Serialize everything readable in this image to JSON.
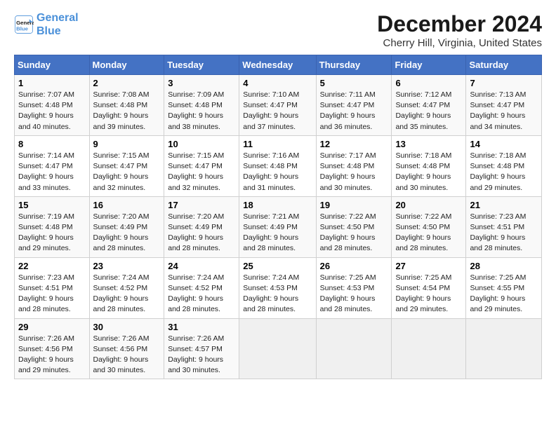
{
  "header": {
    "logo_line1": "General",
    "logo_line2": "Blue",
    "title": "December 2024",
    "location": "Cherry Hill, Virginia, United States"
  },
  "weekdays": [
    "Sunday",
    "Monday",
    "Tuesday",
    "Wednesday",
    "Thursday",
    "Friday",
    "Saturday"
  ],
  "weeks": [
    [
      {
        "day": "1",
        "sunrise": "Sunrise: 7:07 AM",
        "sunset": "Sunset: 4:48 PM",
        "daylight": "Daylight: 9 hours and 40 minutes."
      },
      {
        "day": "2",
        "sunrise": "Sunrise: 7:08 AM",
        "sunset": "Sunset: 4:48 PM",
        "daylight": "Daylight: 9 hours and 39 minutes."
      },
      {
        "day": "3",
        "sunrise": "Sunrise: 7:09 AM",
        "sunset": "Sunset: 4:48 PM",
        "daylight": "Daylight: 9 hours and 38 minutes."
      },
      {
        "day": "4",
        "sunrise": "Sunrise: 7:10 AM",
        "sunset": "Sunset: 4:47 PM",
        "daylight": "Daylight: 9 hours and 37 minutes."
      },
      {
        "day": "5",
        "sunrise": "Sunrise: 7:11 AM",
        "sunset": "Sunset: 4:47 PM",
        "daylight": "Daylight: 9 hours and 36 minutes."
      },
      {
        "day": "6",
        "sunrise": "Sunrise: 7:12 AM",
        "sunset": "Sunset: 4:47 PM",
        "daylight": "Daylight: 9 hours and 35 minutes."
      },
      {
        "day": "7",
        "sunrise": "Sunrise: 7:13 AM",
        "sunset": "Sunset: 4:47 PM",
        "daylight": "Daylight: 9 hours and 34 minutes."
      }
    ],
    [
      {
        "day": "8",
        "sunrise": "Sunrise: 7:14 AM",
        "sunset": "Sunset: 4:47 PM",
        "daylight": "Daylight: 9 hours and 33 minutes."
      },
      {
        "day": "9",
        "sunrise": "Sunrise: 7:15 AM",
        "sunset": "Sunset: 4:47 PM",
        "daylight": "Daylight: 9 hours and 32 minutes."
      },
      {
        "day": "10",
        "sunrise": "Sunrise: 7:15 AM",
        "sunset": "Sunset: 4:47 PM",
        "daylight": "Daylight: 9 hours and 32 minutes."
      },
      {
        "day": "11",
        "sunrise": "Sunrise: 7:16 AM",
        "sunset": "Sunset: 4:48 PM",
        "daylight": "Daylight: 9 hours and 31 minutes."
      },
      {
        "day": "12",
        "sunrise": "Sunrise: 7:17 AM",
        "sunset": "Sunset: 4:48 PM",
        "daylight": "Daylight: 9 hours and 30 minutes."
      },
      {
        "day": "13",
        "sunrise": "Sunrise: 7:18 AM",
        "sunset": "Sunset: 4:48 PM",
        "daylight": "Daylight: 9 hours and 30 minutes."
      },
      {
        "day": "14",
        "sunrise": "Sunrise: 7:18 AM",
        "sunset": "Sunset: 4:48 PM",
        "daylight": "Daylight: 9 hours and 29 minutes."
      }
    ],
    [
      {
        "day": "15",
        "sunrise": "Sunrise: 7:19 AM",
        "sunset": "Sunset: 4:48 PM",
        "daylight": "Daylight: 9 hours and 29 minutes."
      },
      {
        "day": "16",
        "sunrise": "Sunrise: 7:20 AM",
        "sunset": "Sunset: 4:49 PM",
        "daylight": "Daylight: 9 hours and 28 minutes."
      },
      {
        "day": "17",
        "sunrise": "Sunrise: 7:20 AM",
        "sunset": "Sunset: 4:49 PM",
        "daylight": "Daylight: 9 hours and 28 minutes."
      },
      {
        "day": "18",
        "sunrise": "Sunrise: 7:21 AM",
        "sunset": "Sunset: 4:49 PM",
        "daylight": "Daylight: 9 hours and 28 minutes."
      },
      {
        "day": "19",
        "sunrise": "Sunrise: 7:22 AM",
        "sunset": "Sunset: 4:50 PM",
        "daylight": "Daylight: 9 hours and 28 minutes."
      },
      {
        "day": "20",
        "sunrise": "Sunrise: 7:22 AM",
        "sunset": "Sunset: 4:50 PM",
        "daylight": "Daylight: 9 hours and 28 minutes."
      },
      {
        "day": "21",
        "sunrise": "Sunrise: 7:23 AM",
        "sunset": "Sunset: 4:51 PM",
        "daylight": "Daylight: 9 hours and 28 minutes."
      }
    ],
    [
      {
        "day": "22",
        "sunrise": "Sunrise: 7:23 AM",
        "sunset": "Sunset: 4:51 PM",
        "daylight": "Daylight: 9 hours and 28 minutes."
      },
      {
        "day": "23",
        "sunrise": "Sunrise: 7:24 AM",
        "sunset": "Sunset: 4:52 PM",
        "daylight": "Daylight: 9 hours and 28 minutes."
      },
      {
        "day": "24",
        "sunrise": "Sunrise: 7:24 AM",
        "sunset": "Sunset: 4:52 PM",
        "daylight": "Daylight: 9 hours and 28 minutes."
      },
      {
        "day": "25",
        "sunrise": "Sunrise: 7:24 AM",
        "sunset": "Sunset: 4:53 PM",
        "daylight": "Daylight: 9 hours and 28 minutes."
      },
      {
        "day": "26",
        "sunrise": "Sunrise: 7:25 AM",
        "sunset": "Sunset: 4:53 PM",
        "daylight": "Daylight: 9 hours and 28 minutes."
      },
      {
        "day": "27",
        "sunrise": "Sunrise: 7:25 AM",
        "sunset": "Sunset: 4:54 PM",
        "daylight": "Daylight: 9 hours and 29 minutes."
      },
      {
        "day": "28",
        "sunrise": "Sunrise: 7:25 AM",
        "sunset": "Sunset: 4:55 PM",
        "daylight": "Daylight: 9 hours and 29 minutes."
      }
    ],
    [
      {
        "day": "29",
        "sunrise": "Sunrise: 7:26 AM",
        "sunset": "Sunset: 4:56 PM",
        "daylight": "Daylight: 9 hours and 29 minutes."
      },
      {
        "day": "30",
        "sunrise": "Sunrise: 7:26 AM",
        "sunset": "Sunset: 4:56 PM",
        "daylight": "Daylight: 9 hours and 30 minutes."
      },
      {
        "day": "31",
        "sunrise": "Sunrise: 7:26 AM",
        "sunset": "Sunset: 4:57 PM",
        "daylight": "Daylight: 9 hours and 30 minutes."
      },
      null,
      null,
      null,
      null
    ]
  ]
}
